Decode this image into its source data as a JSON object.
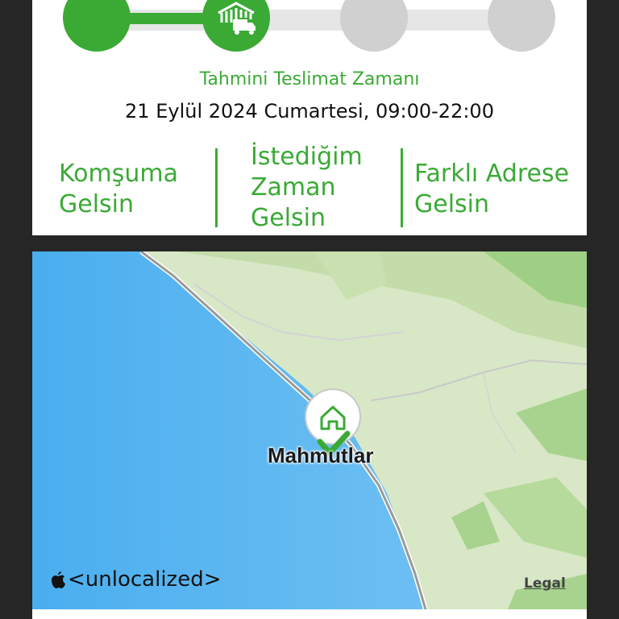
{
  "tracker": {
    "steps": [
      {
        "status": "complete",
        "icon": "check-circle"
      },
      {
        "status": "complete",
        "icon": "warehouse-truck-icon"
      },
      {
        "status": "pending",
        "icon": "empty-circle"
      },
      {
        "status": "pending",
        "icon": "empty-circle"
      }
    ],
    "progress_color": "#3aaa35",
    "pending_color": "#d0d0d0"
  },
  "delivery": {
    "eta_label": "Tahmini Teslimat Zamanı",
    "eta_value": "21 Eylül 2024 Cumartesi, 09:00-22:00"
  },
  "options": {
    "neighbor": "Komşuma Gelsin",
    "scheduled": "İstediğim Zaman Gelsin",
    "other_address": "Farklı Adrese Gelsin"
  },
  "map": {
    "place_name": "Mahmutlar",
    "pin_icon": "home-icon",
    "attribution": "<unlocalized>",
    "legal": "Legal",
    "water_color": "#5fb6ef",
    "land_color": "#d6e6c4"
  },
  "colors": {
    "accent": "#3aaa35",
    "background": "#262626"
  }
}
